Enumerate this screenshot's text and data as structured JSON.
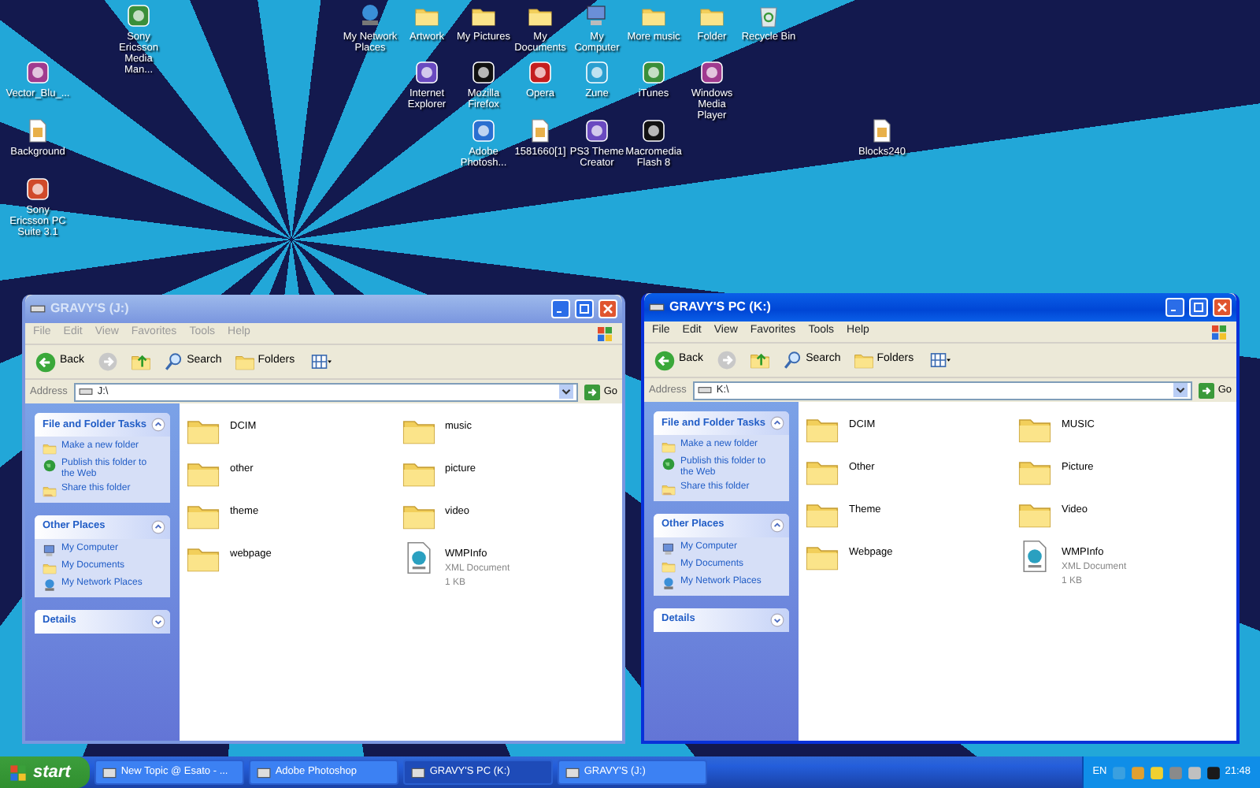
{
  "desktop": {
    "icons": [
      {
        "label": "Sony Ericsson Media Man...",
        "kind": "app"
      },
      {
        "label": "Vector_Blu_...",
        "kind": "app"
      },
      {
        "label": "Background",
        "kind": "file"
      },
      {
        "label": "Sony Ericsson PC Suite 3.1",
        "kind": "app"
      },
      {
        "label": "My Network Places",
        "kind": "network"
      },
      {
        "label": "Artwork",
        "kind": "folder"
      },
      {
        "label": "My Pictures",
        "kind": "folder"
      },
      {
        "label": "My Documents",
        "kind": "folder"
      },
      {
        "label": "My Computer",
        "kind": "computer"
      },
      {
        "label": "More music",
        "kind": "folder"
      },
      {
        "label": "Folder",
        "kind": "folder"
      },
      {
        "label": "Recycle Bin",
        "kind": "bin"
      },
      {
        "label": "Internet Explorer",
        "kind": "app"
      },
      {
        "label": "Mozilla Firefox",
        "kind": "app"
      },
      {
        "label": "Opera",
        "kind": "app"
      },
      {
        "label": "Zune",
        "kind": "app"
      },
      {
        "label": "iTunes",
        "kind": "app"
      },
      {
        "label": "Windows Media Player",
        "kind": "app"
      },
      {
        "label": "Adobe Photosh...",
        "kind": "app"
      },
      {
        "label": "1581660[1]",
        "kind": "file"
      },
      {
        "label": "PS3 Theme Creator",
        "kind": "app"
      },
      {
        "label": "Macromedia Flash 8",
        "kind": "app"
      },
      {
        "label": "Blocks240",
        "kind": "file"
      }
    ]
  },
  "windows": [
    {
      "title": "GRAVY'S (J:)",
      "active": false,
      "menu": [
        "File",
        "Edit",
        "View",
        "Favorites",
        "Tools",
        "Help"
      ],
      "toolbar": {
        "back": "Back",
        "search": "Search",
        "folders": "Folders"
      },
      "address": {
        "label": "Address",
        "value": "J:\\",
        "go": "Go"
      },
      "panels": [
        {
          "title": "File and Folder Tasks",
          "expanded": true,
          "items": [
            {
              "label": "Make a new folder",
              "kind": "newfolder"
            },
            {
              "label": "Publish this folder to the Web",
              "kind": "publish"
            },
            {
              "label": "Share this folder",
              "kind": "share"
            }
          ]
        },
        {
          "title": "Other Places",
          "expanded": true,
          "items": [
            {
              "label": "My Computer",
              "kind": "computer"
            },
            {
              "label": "My Documents",
              "kind": "documents"
            },
            {
              "label": "My Network Places",
              "kind": "network"
            }
          ]
        },
        {
          "title": "Details",
          "expanded": false
        }
      ],
      "files": [
        {
          "name": "DCIM",
          "kind": "folder"
        },
        {
          "name": "music",
          "kind": "folder"
        },
        {
          "name": "other",
          "kind": "folder"
        },
        {
          "name": "picture",
          "kind": "folder"
        },
        {
          "name": "theme",
          "kind": "folder"
        },
        {
          "name": "video",
          "kind": "folder"
        },
        {
          "name": "webpage",
          "kind": "folder"
        },
        {
          "name": "WMPInfo",
          "kind": "xml",
          "details": [
            "XML Document",
            "1 KB"
          ]
        }
      ]
    },
    {
      "title": "GRAVY'S PC (K:)",
      "active": true,
      "menu": [
        "File",
        "Edit",
        "View",
        "Favorites",
        "Tools",
        "Help"
      ],
      "toolbar": {
        "back": "Back",
        "search": "Search",
        "folders": "Folders"
      },
      "address": {
        "label": "Address",
        "value": "K:\\",
        "go": "Go"
      },
      "panels": [
        {
          "title": "File and Folder Tasks",
          "expanded": true,
          "items": [
            {
              "label": "Make a new folder",
              "kind": "newfolder"
            },
            {
              "label": "Publish this folder to the Web",
              "kind": "publish"
            },
            {
              "label": "Share this folder",
              "kind": "share"
            }
          ]
        },
        {
          "title": "Other Places",
          "expanded": true,
          "items": [
            {
              "label": "My Computer",
              "kind": "computer"
            },
            {
              "label": "My Documents",
              "kind": "documents"
            },
            {
              "label": "My Network Places",
              "kind": "network"
            }
          ]
        },
        {
          "title": "Details",
          "expanded": false
        }
      ],
      "files": [
        {
          "name": "DCIM",
          "kind": "folder"
        },
        {
          "name": "MUSIC",
          "kind": "folder"
        },
        {
          "name": "Other",
          "kind": "folder"
        },
        {
          "name": "Picture",
          "kind": "folder"
        },
        {
          "name": "Theme",
          "kind": "folder"
        },
        {
          "name": "Video",
          "kind": "folder"
        },
        {
          "name": "Webpage",
          "kind": "folder"
        },
        {
          "name": "WMPInfo",
          "kind": "xml",
          "details": [
            "XML Document",
            "1 KB"
          ]
        }
      ]
    }
  ],
  "taskbar": {
    "start": "start",
    "tasks": [
      {
        "label": "New Topic @ Esato - ...",
        "selected": false
      },
      {
        "label": "Adobe Photoshop",
        "selected": false
      },
      {
        "label": "GRAVY'S PC (K:)",
        "selected": true
      },
      {
        "label": "GRAVY'S (J:)",
        "selected": false
      }
    ],
    "language": "EN",
    "clock": "21:48"
  }
}
